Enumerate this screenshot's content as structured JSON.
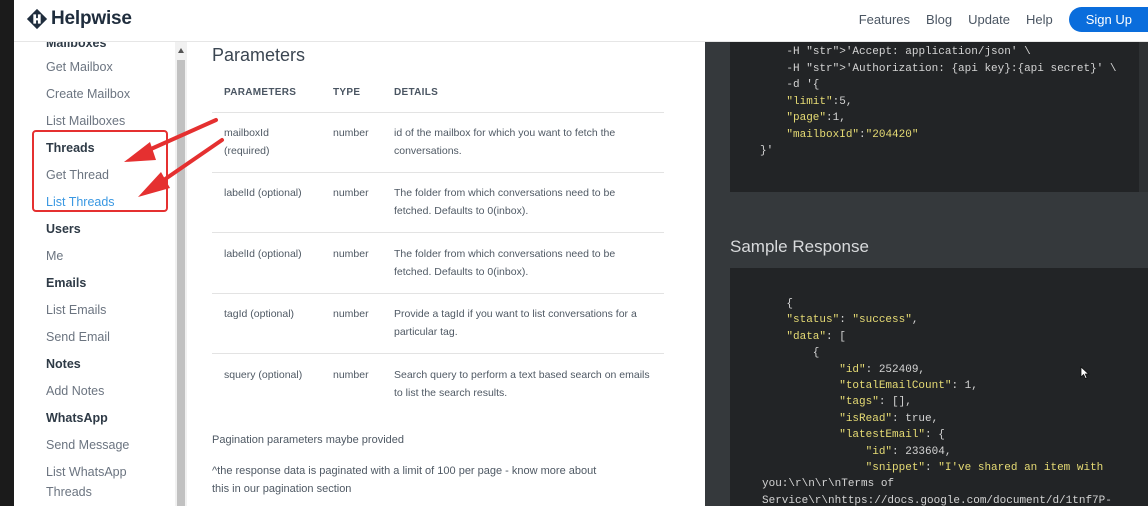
{
  "brand": {
    "name": "Helpwise"
  },
  "nav": {
    "links": [
      "Features",
      "Blog",
      "Update",
      "Help"
    ],
    "signup": "Sign Up"
  },
  "sidebar": {
    "cut_heading": "Mailboxes",
    "items": [
      {
        "label": "Get Mailbox",
        "type": "link"
      },
      {
        "label": "Create Mailbox",
        "type": "link"
      },
      {
        "label": "List Mailboxes",
        "type": "link"
      },
      {
        "label": "Threads",
        "type": "heading"
      },
      {
        "label": "Get Thread",
        "type": "link"
      },
      {
        "label": "List Threads",
        "type": "active"
      },
      {
        "label": "Users",
        "type": "heading"
      },
      {
        "label": "Me",
        "type": "link"
      },
      {
        "label": "Emails",
        "type": "heading"
      },
      {
        "label": "List Emails",
        "type": "link"
      },
      {
        "label": "Send Email",
        "type": "link"
      },
      {
        "label": "Notes",
        "type": "heading"
      },
      {
        "label": "Add Notes",
        "type": "link"
      },
      {
        "label": "WhatsApp",
        "type": "heading"
      },
      {
        "label": "Send Message",
        "type": "link"
      },
      {
        "label": "List WhatsApp",
        "type": "link"
      },
      {
        "label": "Threads",
        "type": "link"
      }
    ]
  },
  "main": {
    "title": "Parameters",
    "table": {
      "headers": [
        "PARAMETERS",
        "TYPE",
        "DETAILS"
      ],
      "rows": [
        {
          "param": [
            "mailboxId",
            "(required)"
          ],
          "type": "number",
          "details": [
            "id of the mailbox for which you want to fetch the",
            "conversations."
          ]
        },
        {
          "param": [
            "labelId (optional)"
          ],
          "type": "number",
          "details": [
            "The folder from which conversations need to be",
            "fetched. Defaults to 0(inbox)."
          ]
        },
        {
          "param": [
            "labelId (optional)"
          ],
          "type": "number",
          "details": [
            "The folder from which conversations need to be",
            "fetched. Defaults to 0(inbox)."
          ]
        },
        {
          "param": [
            "tagId (optional)"
          ],
          "type": "number",
          "details": [
            "Provide a tagId if you want to list conversations for a",
            "particular tag."
          ]
        },
        {
          "param": [
            "squery (optional)"
          ],
          "type": "number",
          "details": [
            "Search query to perform a text based search on emails",
            "to list the search results."
          ]
        }
      ]
    },
    "pagination_note": "Pagination parameters maybe provided",
    "pagination_detail": [
      "^the response data is paginated with a limit of 100 per page - know more about",
      "this in our pagination section"
    ]
  },
  "code": {
    "request_lines": [
      "    -H 'Accept: application/json' \\",
      "    -H 'Authorization: {api key}:{api secret}' \\",
      "    -d '{",
      "    \"limit\":5,",
      "    \"page\":1,",
      "    \"mailboxId\":\"204420\"",
      "}'"
    ],
    "sample_title": "Sample Response",
    "response_lines": [
      "    {",
      "    \"status\": \"success\",",
      "    \"data\": [",
      "        {",
      "            \"id\": 252409,",
      "            \"totalEmailCount\": 1,",
      "            \"tags\": [],",
      "            \"isRead\": true,",
      "            \"latestEmail\": {",
      "                \"id\": 233604,",
      "                \"snippet\": \"I've shared an item with",
      "you:\\r\\n\\r\\nTerms of",
      "Service\\r\\nhttps://docs.google.com/document/d/1tnf7P-"
    ]
  },
  "colors": {
    "accent": "#0a6ddc",
    "active_link": "#3a98e2",
    "annotation": "#e53030",
    "code_bg": "#222426",
    "code_string": "#e6db74"
  }
}
